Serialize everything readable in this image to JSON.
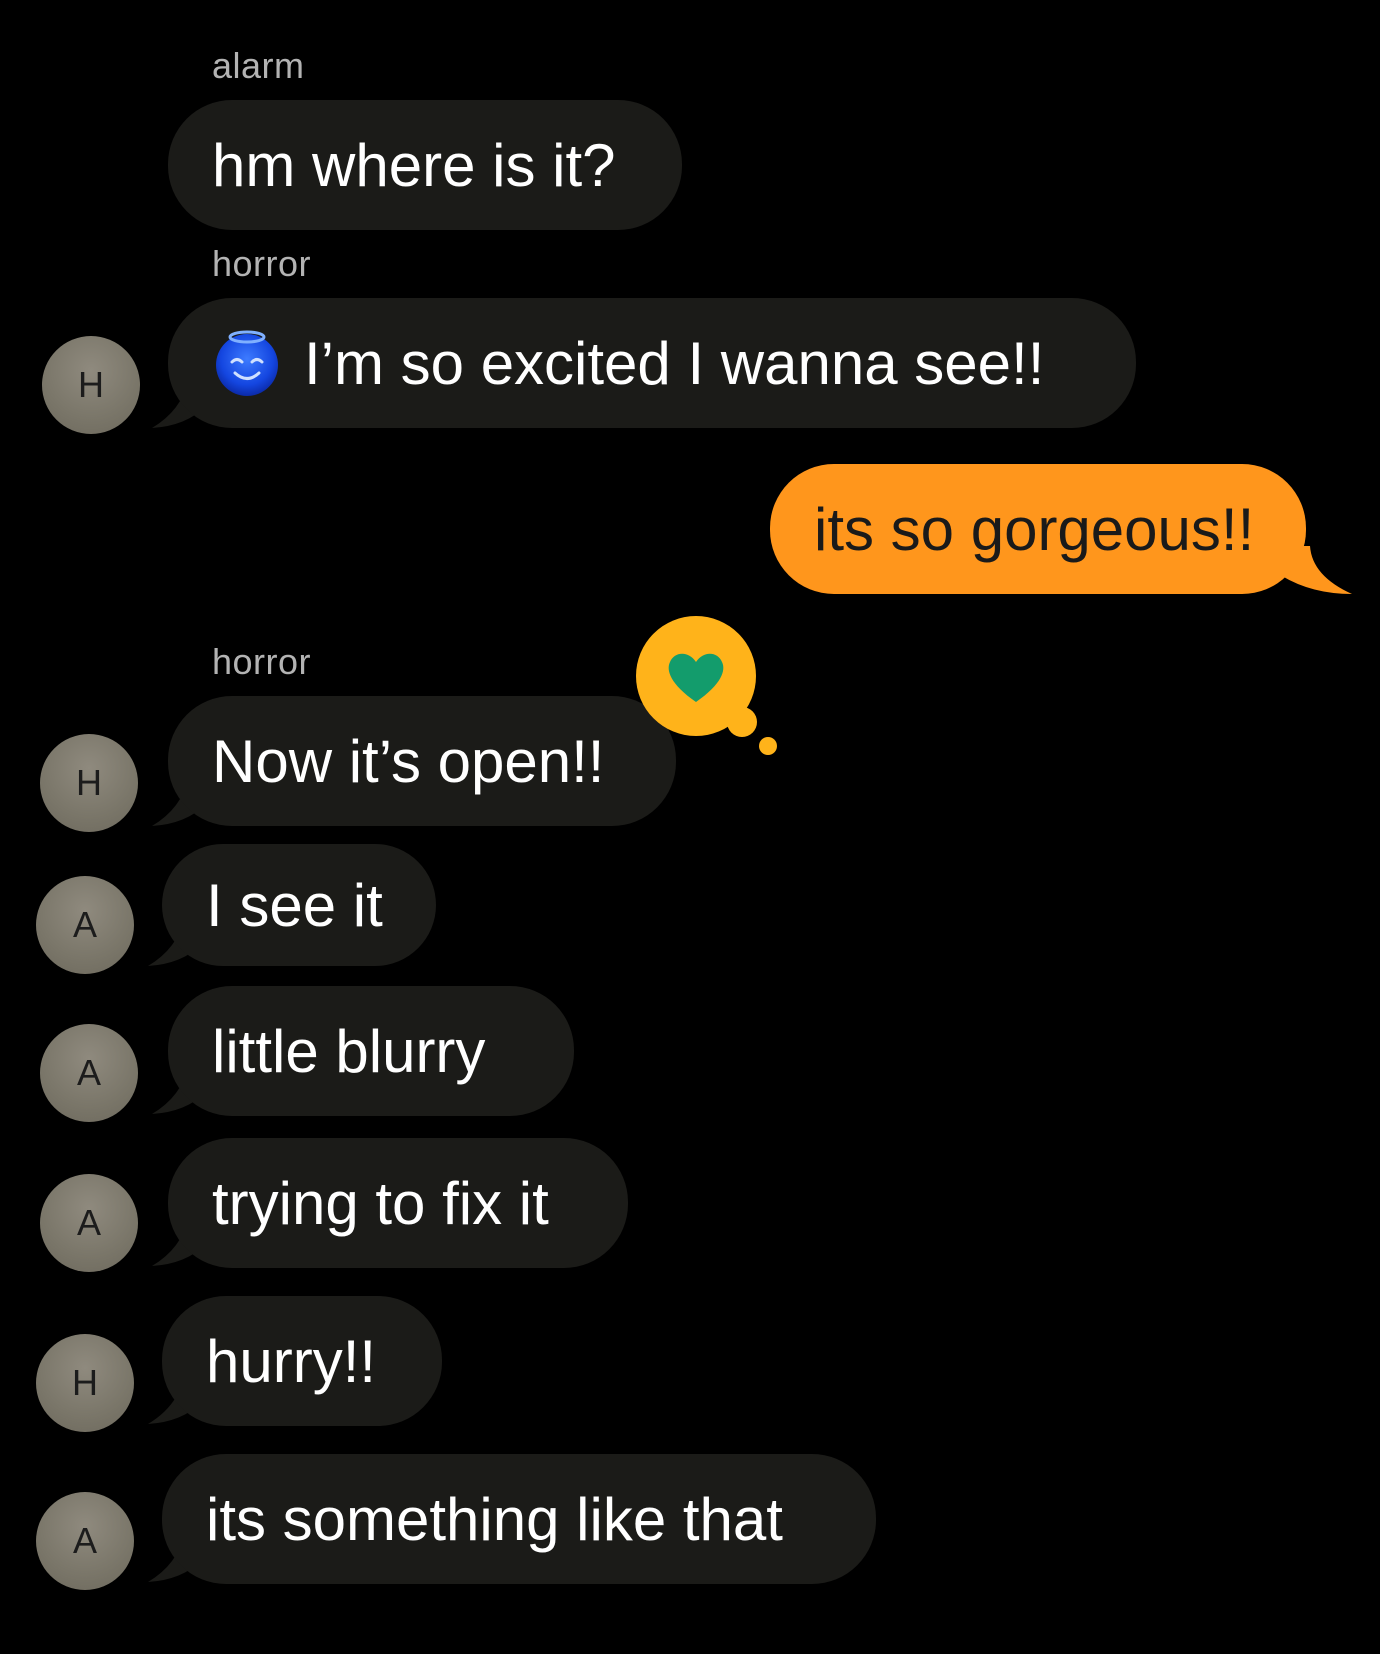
{
  "colors": {
    "background": "#000000",
    "incoming_bubble": "#1b1b18",
    "outgoing_bubble": "#ff961c",
    "avatar": "#7a7669",
    "reaction_bubble": "#ffb31a",
    "reaction_heart": "#139c6c"
  },
  "messages": [
    {
      "sender_label": "alarm",
      "text": "hm where is it?",
      "direction": "incoming"
    },
    {
      "sender_label": "horror",
      "avatar": "H",
      "emoji": "smiling-face-with-halo-icon",
      "text": "I’m so excited I wanna see!!",
      "direction": "incoming"
    },
    {
      "text": "its so gorgeous!!",
      "direction": "outgoing"
    },
    {
      "sender_label": "horror",
      "avatar": "H",
      "text": "Now it’s open!!",
      "direction": "incoming",
      "reaction": "heart-icon"
    },
    {
      "avatar": "A",
      "text": "I see it",
      "direction": "incoming"
    },
    {
      "avatar": "A",
      "text": "little blurry",
      "direction": "incoming"
    },
    {
      "avatar": "A",
      "text": "trying to fix it",
      "direction": "incoming"
    },
    {
      "avatar": "H",
      "text": "hurry!!",
      "direction": "incoming"
    },
    {
      "avatar": "A",
      "text": "its something like that",
      "direction": "incoming"
    }
  ]
}
